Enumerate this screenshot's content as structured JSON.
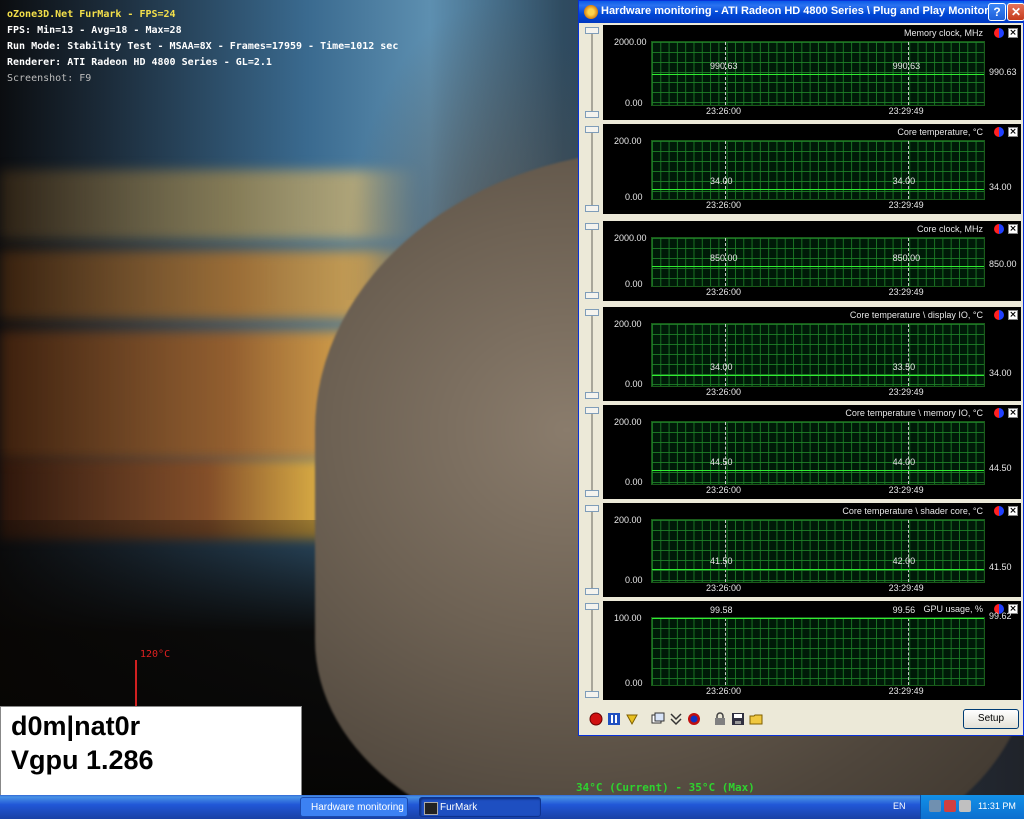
{
  "furmark": {
    "title": "oZone3D.Net FurMark - FPS=24",
    "fps_line": "FPS: Min=13 - Avg=18 - Max=28",
    "run_line": "Run Mode: Stability Test - MSAA=8X - Frames=17959 - Time=1012 sec",
    "renderer_line": "Renderer: ATI Radeon HD 4800 Series - GL=2.1",
    "screenshot_hint": "Screenshot: F9",
    "temp_max_marker": "120°C",
    "temp_status": "34°C (Current) - 35°C (Max)"
  },
  "overlay": {
    "name": "d0m|nat0r",
    "vgpu": "Vgpu 1.286"
  },
  "hw_window": {
    "title": "Hardware monitoring - ATI Radeon HD 4800 Series \\ Plug and Play Monitor",
    "help_label": "?",
    "close_label": "✕",
    "graphs": [
      {
        "name": "Memory clock, MHz",
        "ymax": "2000.00",
        "ymin": "0.00",
        "val_left": "990.63",
        "val_mid": "990.63",
        "val_right": "990.63",
        "t1": "23:26:00",
        "t2": "23:29:49",
        "level": 0.495
      },
      {
        "name": "Core temperature, °C",
        "ymax": "200.00",
        "ymin": "0.00",
        "val_left": "34.00",
        "val_mid": "34.00",
        "val_right": "34.00",
        "t1": "23:26:00",
        "t2": "23:29:49",
        "level": 0.17
      },
      {
        "name": "Core clock, MHz",
        "ymax": "2000.00",
        "ymin": "0.00",
        "val_left": "850.00",
        "val_mid": "850.00",
        "val_right": "850.00",
        "t1": "23:26:00",
        "t2": "23:29:49",
        "level": 0.425
      },
      {
        "name": "Core temperature \\ display IO, °C",
        "ymax": "200.00",
        "ymin": "0.00",
        "val_left": "34.00",
        "val_mid": "33.50",
        "val_right": "34.00",
        "t1": "23:26:00",
        "t2": "23:29:49",
        "level": 0.17
      },
      {
        "name": "Core temperature \\ memory IO, °C",
        "ymax": "200.00",
        "ymin": "0.00",
        "val_left": "44.50",
        "val_mid": "44.00",
        "val_right": "44.50",
        "t1": "23:26:00",
        "t2": "23:29:49",
        "level": 0.2225
      },
      {
        "name": "Core temperature \\ shader core, °C",
        "ymax": "200.00",
        "ymin": "0.00",
        "val_left": "41.50",
        "val_mid": "42.00",
        "val_right": "41.50",
        "t1": "23:26:00",
        "t2": "23:29:49",
        "level": 0.2075
      },
      {
        "name": "GPU usage, %",
        "ymax": "100.00",
        "ymin": "0.00",
        "val_left": "99.58",
        "val_mid": "99.56",
        "val_right": "99.62",
        "t1": "23:26:00",
        "t2": "23:29:49",
        "level": 0.996
      }
    ],
    "setup_label": "Setup"
  },
  "taskbar": {
    "task_hw": "Hardware monitoring ...",
    "task_furmark": "FurMark",
    "language": "EN",
    "clock": "11:31 PM"
  },
  "icons": {
    "record": "record-icon",
    "pause": "pause-icon",
    "clear": "clear-icon",
    "windows": "windows-icon",
    "collapse": "collapse-icon",
    "ati": "ati-icon",
    "lock": "lock-icon",
    "save": "save-icon",
    "open": "open-folder-icon"
  }
}
